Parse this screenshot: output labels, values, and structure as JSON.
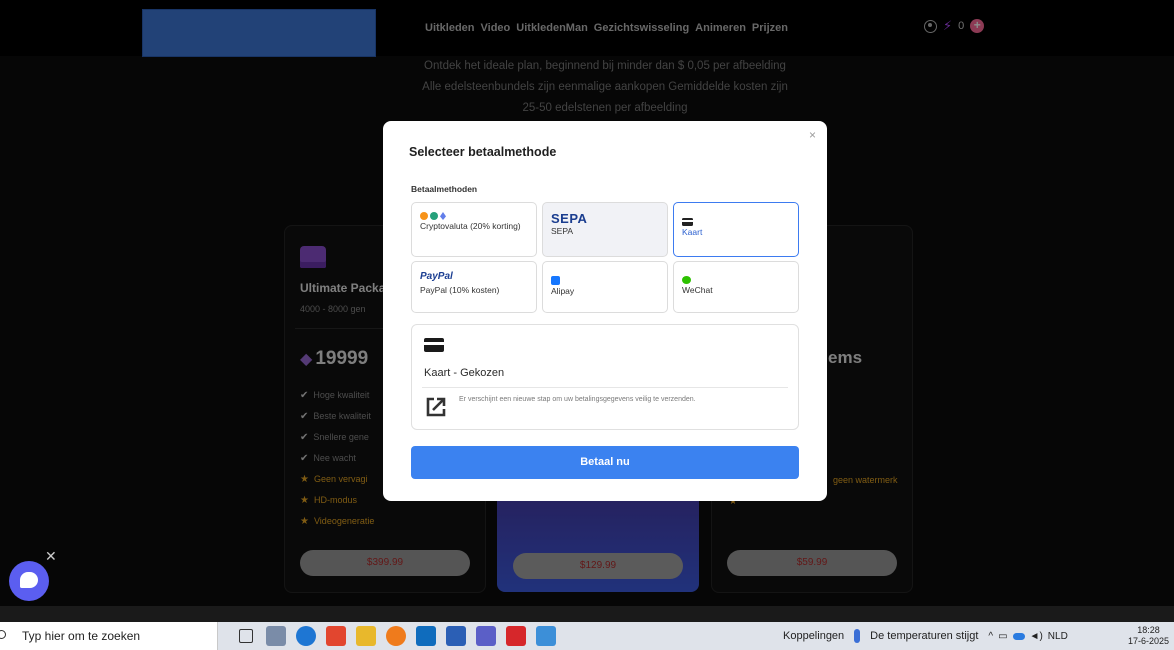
{
  "nav": {
    "links": [
      "Uitkleden",
      "Video",
      "UitkledenMan",
      "Gezichtswisseling",
      "Animeren",
      "Prijzen"
    ],
    "gem_count": "0"
  },
  "intro": {
    "line1": "Ontdek het ideale plan, beginnend bij minder dan $ 0,05 per afbeelding",
    "line2": "Alle edelsteenbundels zijn eenmalige aankopen Gemiddelde kosten zijn",
    "line3": "25-50 edelstenen per afbeelding"
  },
  "packages": {
    "left": {
      "title": "Ultimate Packa",
      "subtitle": "4000 - 8000 gen",
      "price": "19999",
      "features": [
        "Hoge kwaliteit",
        "Beste kwaliteit",
        "Snellere gene",
        "Nee wacht"
      ],
      "star_features": [
        "Geen vervagi",
        "HD-modus",
        "Videogeneratie"
      ],
      "button": "$399.99"
    },
    "middle": {
      "button": "$129.99"
    },
    "right": {
      "price_suffix": "ems",
      "note": "geen watermerk",
      "button": "$59.99"
    }
  },
  "modal": {
    "title": "Selecteer betaalmethode",
    "methods_label": "Betaalmethoden",
    "methods": [
      {
        "label": "Cryptovaluta (20% korting)",
        "icon": "crypto-icons"
      },
      {
        "label": "SEPA",
        "logo": "SEPA",
        "icon": "sepa-logo"
      },
      {
        "label": "Kaart",
        "icon": "card-icon",
        "selected": true
      },
      {
        "label": "PayPal (10% kosten)",
        "logo": "PayPal",
        "icon": "paypal-logo"
      },
      {
        "label": "Alipay",
        "icon": "alipay-icon"
      },
      {
        "label": "WeChat",
        "icon": "wechat-icon"
      }
    ],
    "chosen": "Kaart - Gekozen",
    "note": "Er verschijnt een nieuwe stap om uw betalingsgegevens veilig te verzenden.",
    "pay_button": "Betaal nu",
    "close": "×"
  },
  "taskbar": {
    "search_placeholder": "Typ hier om te zoeken",
    "links_label": "Koppelingen",
    "weather": "De temperaturen stijgt",
    "language": "NLD",
    "time": "18:28",
    "date": "17-6-2025"
  },
  "colors": {
    "accent": "#3b82f0",
    "selected_border": "#3d7bf0",
    "star": "#e7a623",
    "logo_block": "#3f79d9"
  }
}
